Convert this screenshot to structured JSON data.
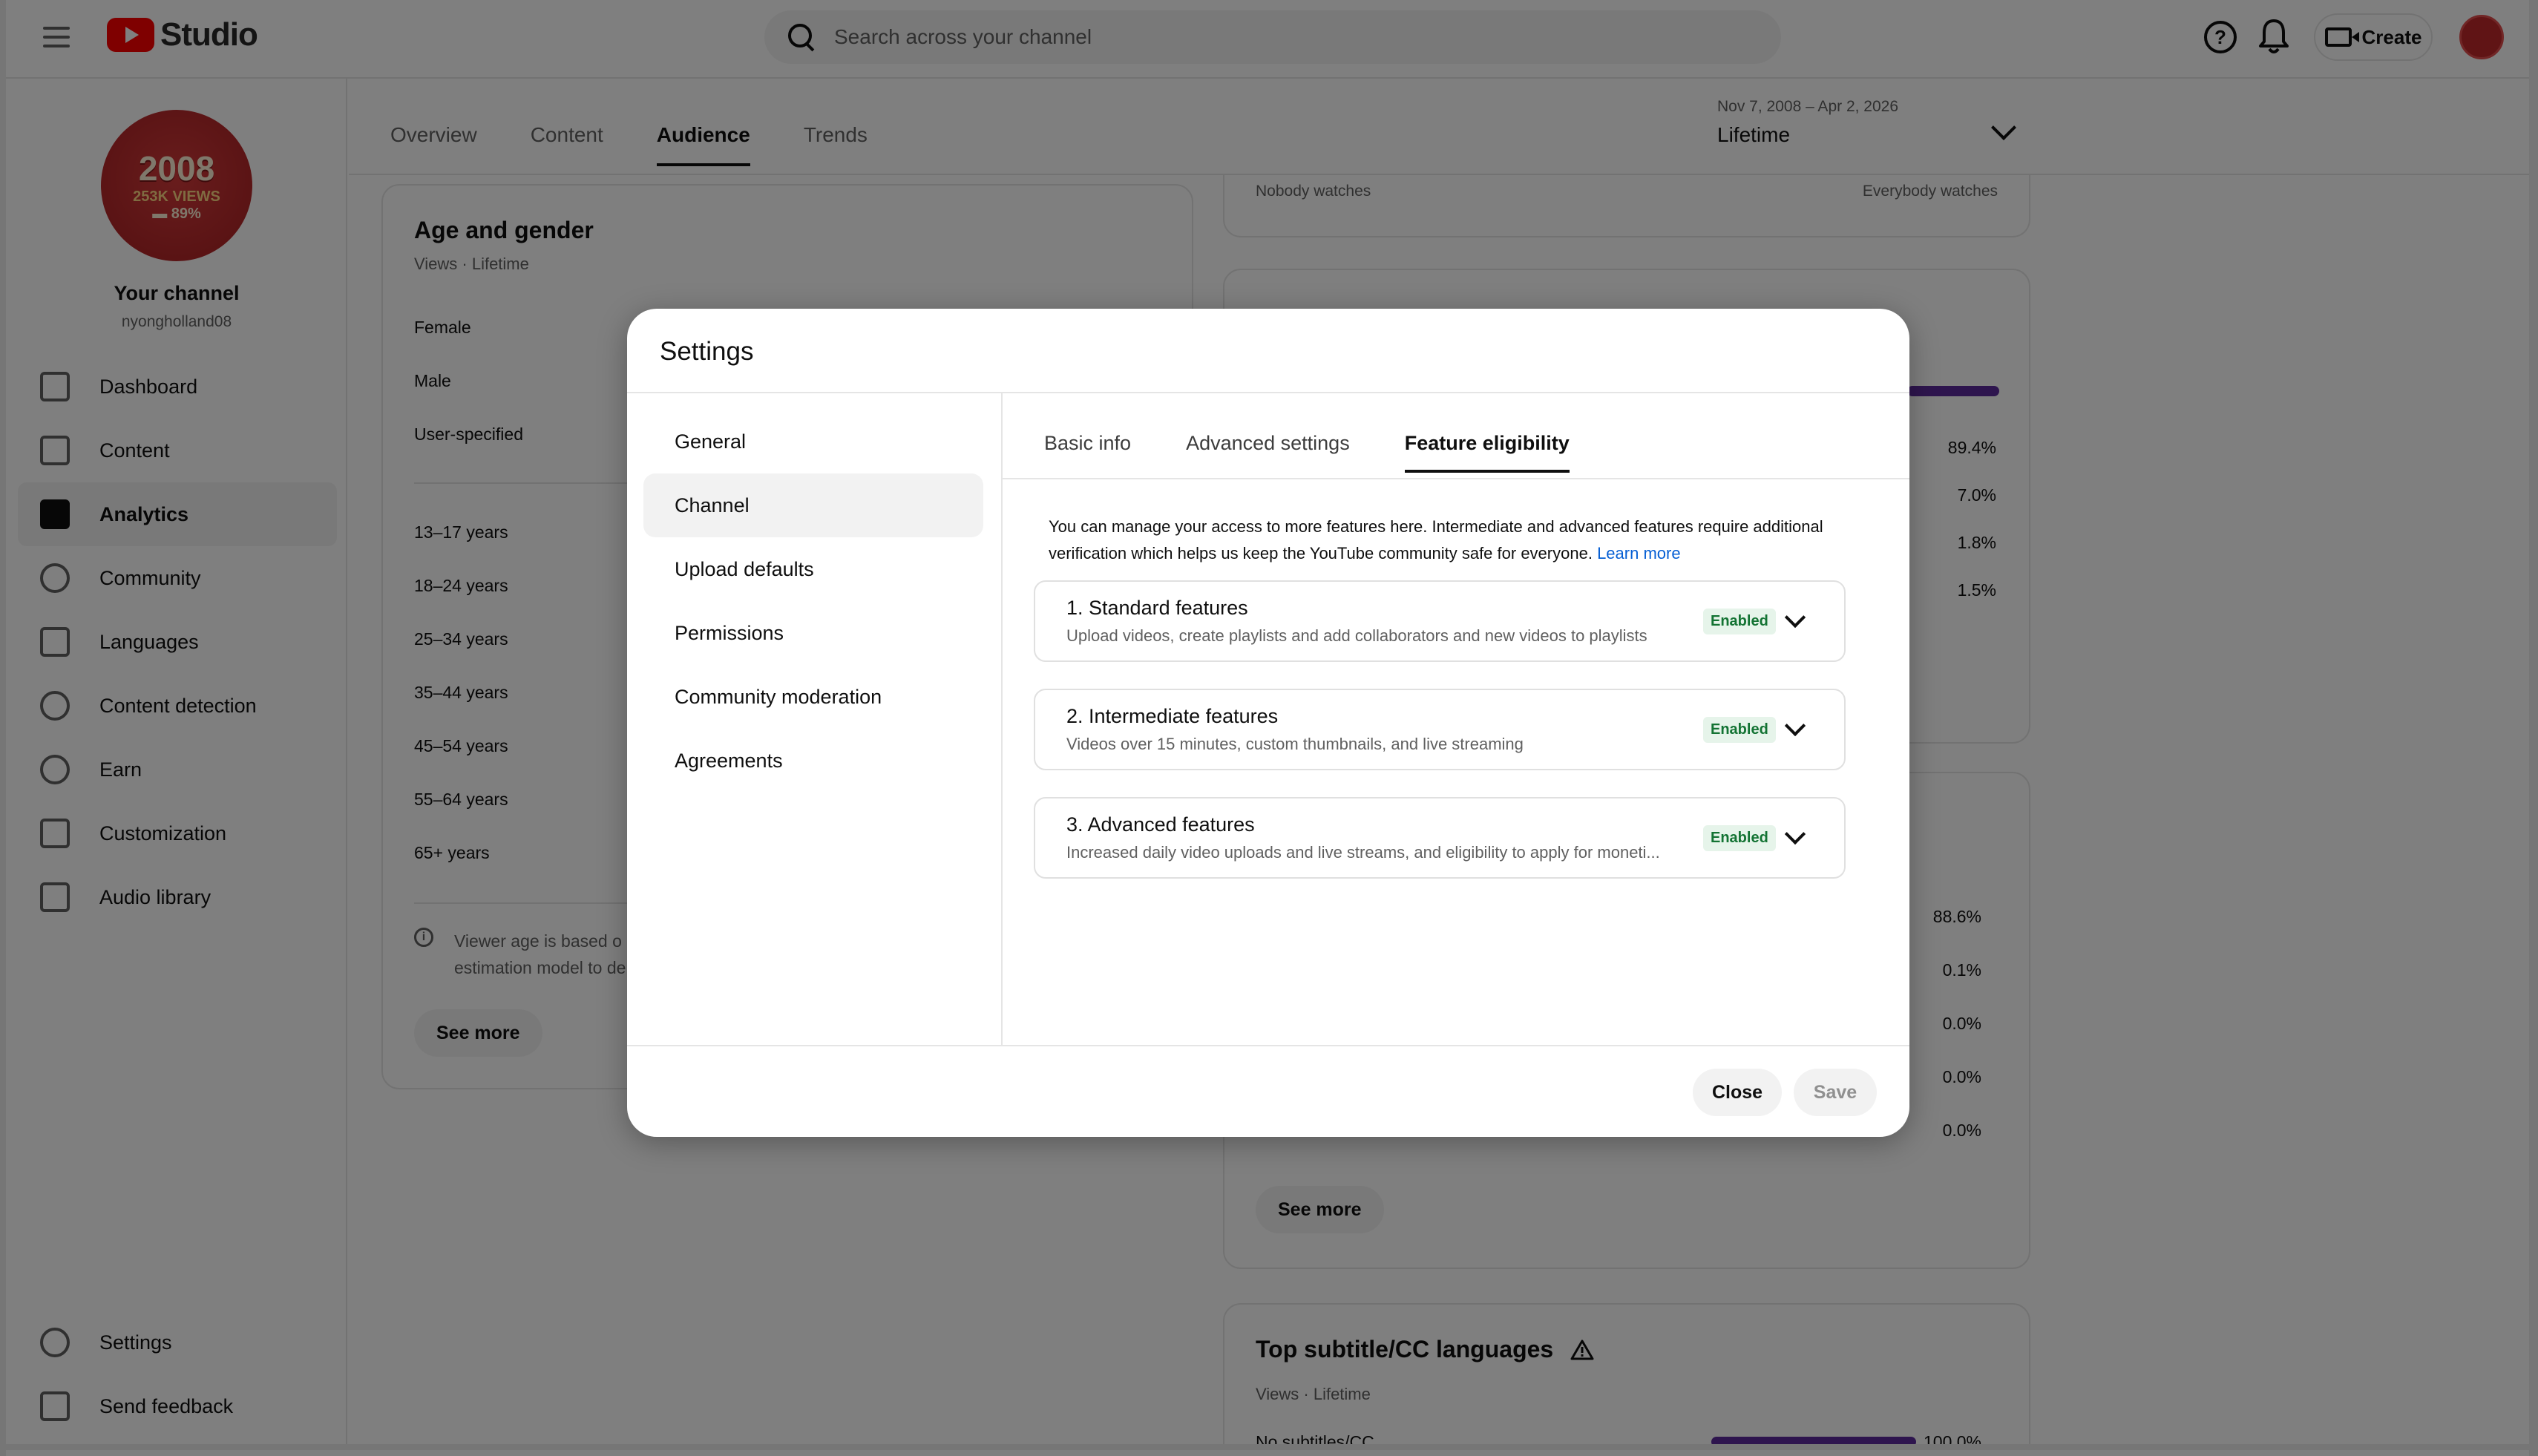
{
  "app": {
    "logo_text": "Studio",
    "search_placeholder": "Search across your channel",
    "create_label": "Create"
  },
  "sidebar": {
    "channel_title": "Your channel",
    "channel_handle": "nyongholland08",
    "avatar_text": [
      "2008",
      "253K VIEWS",
      "▬ 89%"
    ],
    "items": [
      {
        "label": "Dashboard",
        "icon": "dashboard-icon"
      },
      {
        "label": "Content",
        "icon": "content-icon"
      },
      {
        "label": "Analytics",
        "icon": "analytics-icon",
        "active": true
      },
      {
        "label": "Community",
        "icon": "community-icon"
      },
      {
        "label": "Languages",
        "icon": "languages-icon"
      },
      {
        "label": "Content detection",
        "icon": "copyright-icon"
      },
      {
        "label": "Earn",
        "icon": "dollar-icon"
      },
      {
        "label": "Customization",
        "icon": "magic-wand-icon"
      },
      {
        "label": "Audio library",
        "icon": "audio-library-icon"
      }
    ],
    "bottom_items": [
      {
        "label": "Settings",
        "icon": "gear-icon"
      },
      {
        "label": "Send feedback",
        "icon": "feedback-icon"
      }
    ]
  },
  "analytics": {
    "tabs": [
      "Overview",
      "Content",
      "Audience",
      "Trends"
    ],
    "active_tab": "Audience",
    "date_range": "Nov 7, 2008 – Apr 2, 2026",
    "period": "Lifetime",
    "age_gender": {
      "title": "Age and gender",
      "subtitle": "Views · Lifetime",
      "genders": [
        "Female",
        "Male",
        "User-specified"
      ],
      "ages": [
        "13–17 years",
        "18–24 years",
        "25–34 years",
        "35–44 years",
        "45–54 years",
        "55–64 years",
        "65+ years"
      ],
      "info_line1": "Viewer age is based o",
      "info_line2": "estimation model to de",
      "see_more": "See more"
    },
    "right": {
      "nobody": "Nobody watches",
      "everybody": "Everybody watches",
      "devices_pcts": [
        "89.4%",
        "7.0%",
        "1.8%",
        "1.5%"
      ],
      "lang_pcts": [
        "88.6%",
        "0.1%",
        "0.0%",
        "0.0%",
        "0.0%"
      ],
      "see_more": "See more",
      "subtitle_title": "Top subtitle/CC languages",
      "subtitle_sub": "Views · Lifetime",
      "subtitle_row_label": "No subtitles/CC",
      "subtitle_row_pct": "100.0%"
    }
  },
  "dialog": {
    "title": "Settings",
    "nav": [
      "General",
      "Channel",
      "Upload defaults",
      "Permissions",
      "Community moderation",
      "Agreements"
    ],
    "active_nav": "Channel",
    "tabs": [
      "Basic info",
      "Advanced settings",
      "Feature eligibility"
    ],
    "active_tab": "Feature eligibility",
    "description": "You can manage your access to more features here. Intermediate and advanced features require additional verification which helps us keep the YouTube community safe for everyone.",
    "learn_more": "Learn more",
    "features": [
      {
        "title": "1. Standard features",
        "desc": "Upload videos, create playlists and add collaborators and new videos to playlists",
        "status": "Enabled"
      },
      {
        "title": "2. Intermediate features",
        "desc": "Videos over 15 minutes, custom thumbnails, and live streaming",
        "status": "Enabled"
      },
      {
        "title": "3. Advanced features",
        "desc": "Increased daily video uploads and live streams, and eligibility to apply for moneti...",
        "status": "Enabled"
      }
    ],
    "close_label": "Close",
    "save_label": "Save"
  }
}
